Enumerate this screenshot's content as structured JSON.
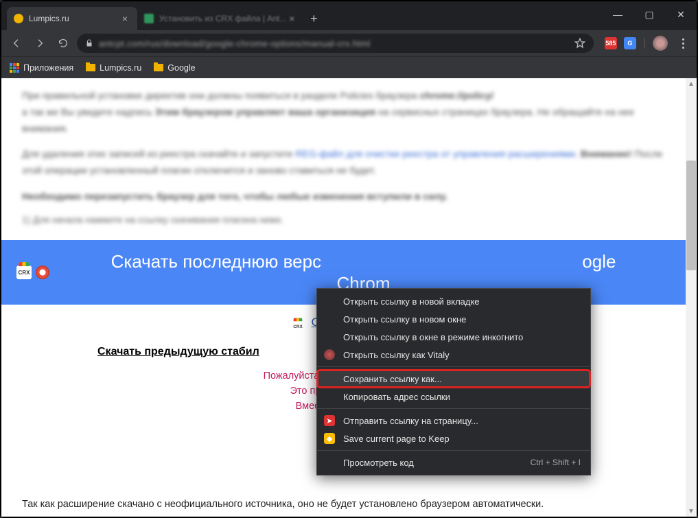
{
  "window": {
    "tabs": [
      {
        "title": "Lumpics.ru",
        "active": true
      },
      {
        "title": "Установить из CRX файла | Ant...",
        "active": false
      }
    ]
  },
  "address_bar": {
    "url_blurred": "antcpt.com/rus/download/google-chrome-options/manual-crx.html"
  },
  "bookmarks": {
    "apps": "Приложения",
    "items": [
      "Lumpics.ru",
      "Google"
    ]
  },
  "extensions": {
    "badge1": "585"
  },
  "page": {
    "banner_line": "Скачать последнюю версию плагина AntiCaptcha для Google Chrome вручную",
    "banner_visible_left": "Скачать последнюю верс",
    "banner_visible_right": "ogle",
    "banner_visible_bottom": "Chrom",
    "download_link_visible": "Скачать послед",
    "prev_link_visible": "Скачать предыдущую стабил",
    "warning_line1_visible": "Пожалуйста не копируйте и не рас",
    "warning_line2_visible": "Это приведет к ошибке ",
    "warning_line3_visible": "Вместо этого привод",
    "footnote": "Так как расширение скачано с неофициального источника, оно не будет установлено браузером автоматически."
  },
  "context_menu": {
    "items": [
      {
        "label": "Открыть ссылку в новой вкладке"
      },
      {
        "label": "Открыть ссылку в новом окне"
      },
      {
        "label": "Открыть ссылку в окне в режиме инкогнито"
      },
      {
        "label": "Открыть ссылку как Vitaly",
        "icon": "avatar"
      },
      {
        "sep": true
      },
      {
        "label": "Сохранить ссылку как...",
        "highlight": true
      },
      {
        "label": "Копировать адрес ссылки"
      },
      {
        "sep": true
      },
      {
        "label": "Отправить ссылку на страницу...",
        "icon": "send"
      },
      {
        "label": "Save current page to Keep",
        "icon": "keep"
      },
      {
        "sep": true
      },
      {
        "label": "Просмотреть код",
        "shortcut": "Ctrl + Shift + I"
      }
    ]
  }
}
